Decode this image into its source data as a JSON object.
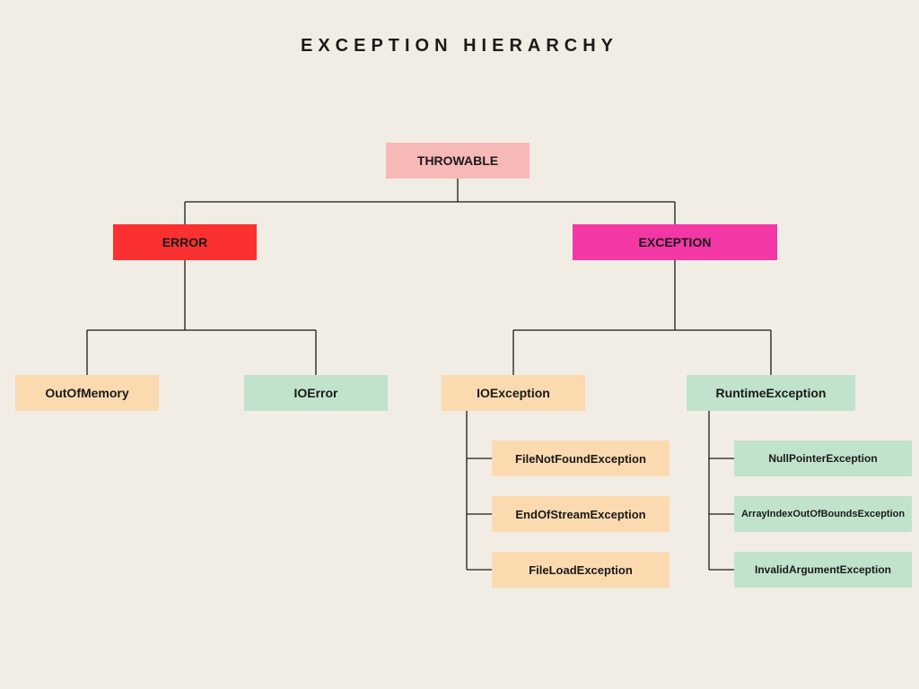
{
  "title": "EXCEPTION HIERARCHY",
  "root": {
    "label": "THROWABLE",
    "color": "pink"
  },
  "level1": [
    {
      "id": "error",
      "label": "ERROR",
      "color": "red"
    },
    {
      "id": "exception",
      "label": "EXCEPTION",
      "color": "magenta"
    }
  ],
  "error_children": [
    {
      "label": "OutOfMemory",
      "color": "peach"
    },
    {
      "label": "IOError",
      "color": "mint"
    }
  ],
  "exception_children": [
    {
      "id": "ioexception",
      "label": "IOException",
      "color": "peach"
    },
    {
      "id": "runtimeexception",
      "label": "RuntimeException",
      "color": "mint"
    }
  ],
  "ioexception_children": [
    {
      "label": "FileNotFoundException",
      "color": "peach"
    },
    {
      "label": "EndOfStreamException",
      "color": "peach"
    },
    {
      "label": "FileLoadException",
      "color": "peach"
    }
  ],
  "runtimeexception_children": [
    {
      "label": "NullPointerException",
      "color": "mint"
    },
    {
      "label": "ArrayIndexOutOfBoundsException",
      "color": "mint"
    },
    {
      "label": "InvalidArgumentException",
      "color": "mint"
    }
  ]
}
